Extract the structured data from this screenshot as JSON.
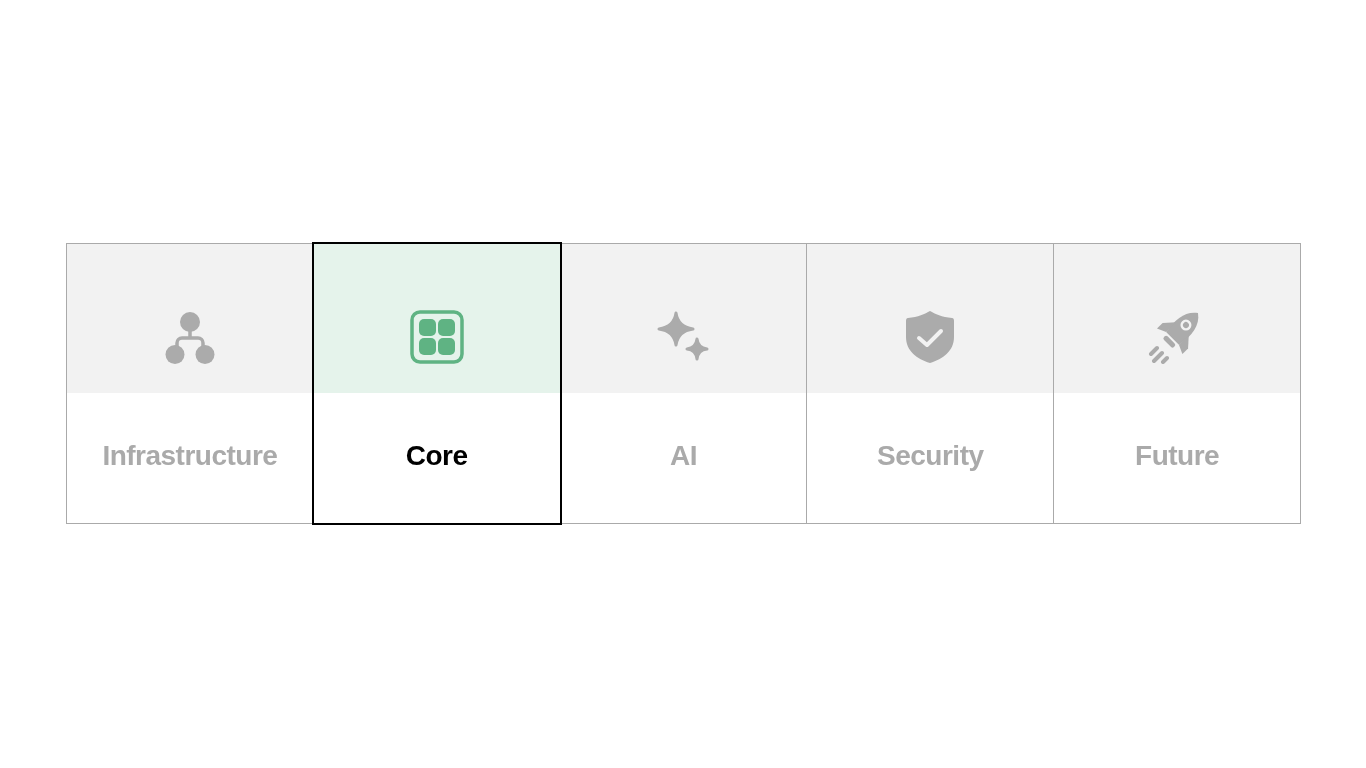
{
  "tabs": [
    {
      "label": "Infrastructure",
      "selected": false
    },
    {
      "label": "Core",
      "selected": true
    },
    {
      "label": "AI",
      "selected": false
    },
    {
      "label": "Security",
      "selected": false
    },
    {
      "label": "Future",
      "selected": false
    }
  ]
}
